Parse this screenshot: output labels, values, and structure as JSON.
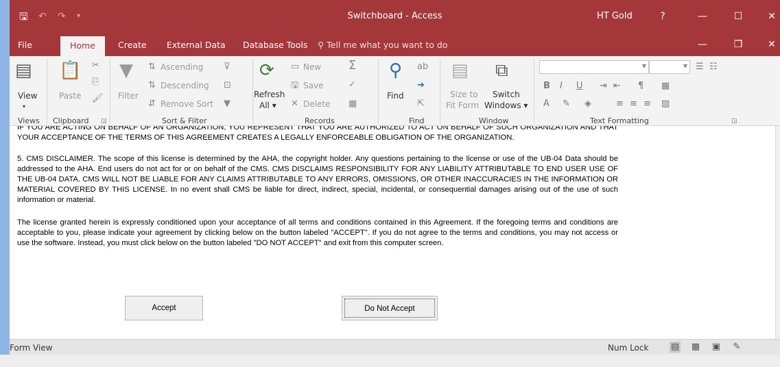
{
  "window": {
    "title": "Switchboard - Access",
    "user": "HT Gold",
    "help": "?",
    "minimize": "—",
    "maximize": "☐",
    "close": "✕"
  },
  "qat": {
    "save": "🖫",
    "undo": "↶",
    "redo": "↷",
    "more": "▾"
  },
  "tabs": [
    "File",
    "Home",
    "Create",
    "External Data",
    "Database Tools"
  ],
  "tell_me": "Tell me what you want to do",
  "tabbar_controls": {
    "minimize": "—",
    "restore": "❐",
    "close": "✕"
  },
  "ribbon": {
    "views": {
      "view": "View",
      "group": "Views"
    },
    "clipboard": {
      "paste": "Paste",
      "group": "Clipboard"
    },
    "sort_filter": {
      "filter": "Filter",
      "ascending": "Ascending",
      "descending": "Descending",
      "remove_sort": "Remove Sort",
      "group": "Sort & Filter"
    },
    "records": {
      "refresh": "Refresh",
      "all": "All",
      "new": "New",
      "save": "Save",
      "delete": "Delete",
      "group": "Records"
    },
    "find": {
      "find": "Find",
      "group": "Find"
    },
    "window": {
      "size_to": "Size to",
      "fit_form": "Fit Form",
      "switch": "Switch",
      "windows": "Windows",
      "group": "Window"
    },
    "text_formatting": {
      "bold": "B",
      "italic": "I",
      "underline": "U",
      "group": "Text Formatting"
    },
    "icons": {
      "view": "view-icon",
      "paste": "paste-icon",
      "cut": "cut-icon",
      "copy": "copy-icon",
      "format_painter": "format-painter-icon",
      "filter": "filter-icon",
      "refresh": "refresh-icon",
      "totals": "totals-icon",
      "spelling": "spelling-icon",
      "find": "find-icon",
      "replace": "replace-icon",
      "goto": "goto-icon",
      "select": "select-icon",
      "size_to_fit": "size-to-fit-icon",
      "switch_windows": "switch-windows-icon"
    }
  },
  "document": {
    "cut_text": "IF YOU ARE ACTING ON BEHALF OF AN ORGANIZATION, YOU REPRESENT THAT YOU ARE AUTHORIZED TO ACT ON BEHALF OF SUCH ORGANIZATION AND THAT YOUR ACCEPTANCE OF THE TERMS OF THIS AGREEMENT CREATES A LEGALLY ENFORCEABLE OBLIGATION OF THE ORGANIZATION.",
    "paragraph_5": "5.  CMS DISCLAIMER. The scope of this license is determined by the AHA, the copyright holder. Any questions pertaining to the license or use of the UB-04 Data should be addressed to the AHA.  End users do not act  for or on behalf of the CMS.  CMS DISCLAIMS RESPONSIBILITY FOR ANY LIABILITY ATTRIBUTABLE TO END USER USE OF THE UB-04 DATA. CMS WILL NOT BE LIABLE FOR ANY CLAIMS ATTRIBUTABLE TO ANY ERRORS, OMISSIONS, OR OTHER INACCURACIES IN THE INFORMATION OR MATERIAL COVERED BY THIS LICENSE.  In no event shall CMS be liable for direct, indirect, special, incidental, or consequential damages arising out of the use of such information or material.",
    "paragraph_license": "The license granted herein is expressly conditioned upon your acceptance of all terms and conditions contained in this Agreement.   If the foregoing terms and conditions are acceptable to you, please indicate your agreement by clicking below on the button labeled \"ACCEPT\". If you do not agree to the terms and conditions, you may not access or use the software. Instead, you must click below on the button labeled \"DO NOT ACCEPT\" and exit from this computer screen.",
    "accept_label": "Accept",
    "do_not_accept_label": "Do Not Accept"
  },
  "status": {
    "mode": "Form View",
    "num_lock": "Num Lock"
  },
  "colors": {
    "title_bar": "#a4373a",
    "frame": "#8db6e6",
    "ribbon": "#f3f3f3"
  }
}
